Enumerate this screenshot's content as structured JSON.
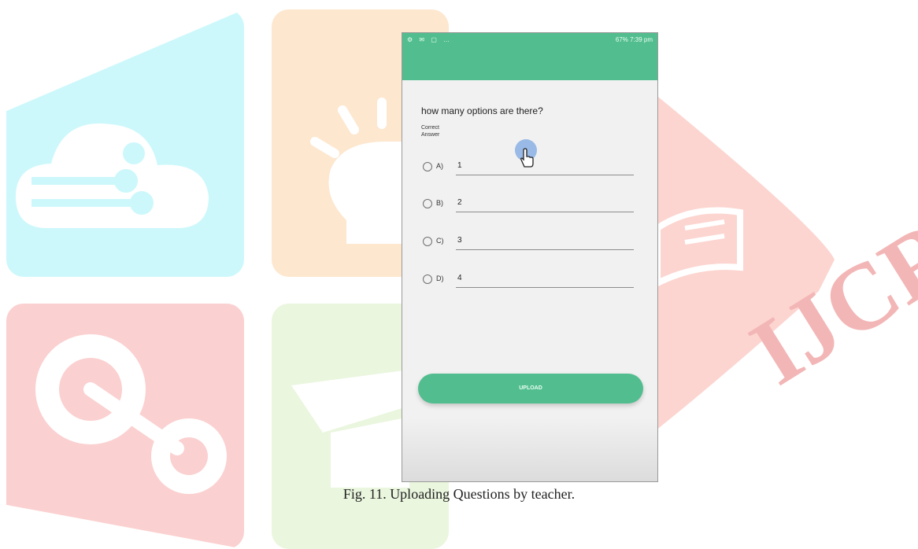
{
  "watermark": {
    "text": "IJCRT"
  },
  "status_bar": {
    "left_icons": "⚙ ✉ ▢ …",
    "right_text": "67% 7:39 pm"
  },
  "form": {
    "question": "how many options are there?",
    "correct_answer_label_line1": "Correct",
    "correct_answer_label_line2": "Answer",
    "options": [
      {
        "letter": "A)",
        "value": "1",
        "selected": false
      },
      {
        "letter": "B)",
        "value": "2",
        "selected": false
      },
      {
        "letter": "C)",
        "value": "3",
        "selected": false
      },
      {
        "letter": "D)",
        "value": "4",
        "selected": false
      }
    ],
    "upload_label": "UPLOAD"
  },
  "colors": {
    "accent": "#52bd8e",
    "screen_bg": "#f1f1f1"
  },
  "caption": "Fig. 11. Uploading Questions by teacher."
}
